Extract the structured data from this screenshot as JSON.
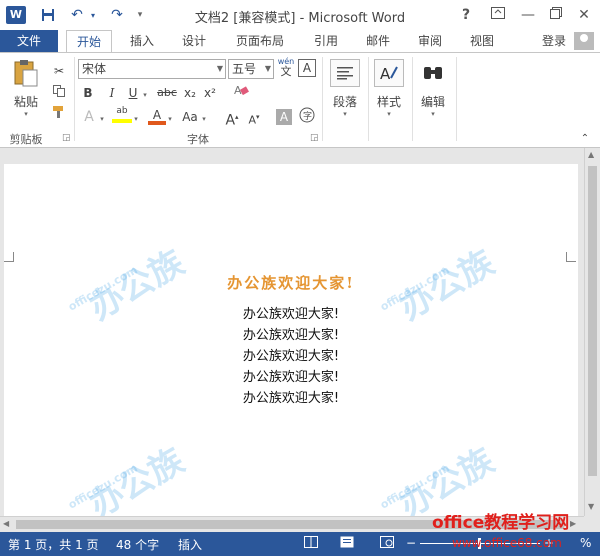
{
  "window": {
    "title": "文档2 [兼容模式] - Microsoft Word",
    "help": "?",
    "word_logo": "W"
  },
  "tabs": {
    "file": "文件",
    "home": "开始",
    "insert": "插入",
    "design": "设计",
    "layout": "页面布局",
    "references": "引用",
    "mailings": "邮件",
    "review": "审阅",
    "view": "视图",
    "login": "登录"
  },
  "ribbon": {
    "clipboard": {
      "paste": "粘贴",
      "group": "剪贴板"
    },
    "font": {
      "font_name": "宋体",
      "font_size": "五号",
      "wen": "wén",
      "group": "字体",
      "bold": "B",
      "italic": "I",
      "underline": "U",
      "strike": "abc",
      "sub": "x₂",
      "sup": "x²",
      "change_case": "Aa"
    },
    "paragraph": {
      "label": "段落"
    },
    "styles": {
      "label": "样式"
    },
    "editing": {
      "label": "编辑"
    }
  },
  "document": {
    "heading": "办公族欢迎大家!",
    "lines": [
      "办公族欢迎大家!",
      "办公族欢迎大家!",
      "办公族欢迎大家!",
      "办公族欢迎大家!",
      "办公族欢迎大家!"
    ]
  },
  "status": {
    "page": "第 1 页，共 1 页",
    "words": "48 个字",
    "mode": "插入",
    "zoom": "%"
  },
  "watermark": {
    "site": "officezu.com",
    "brand": "办公族",
    "footer_brand": "office教程学习网",
    "footer_url": "www.office68.com"
  },
  "colors": {
    "accent": "#2b579a",
    "heading": "#e59532",
    "footer_brand": "#e0201c"
  }
}
